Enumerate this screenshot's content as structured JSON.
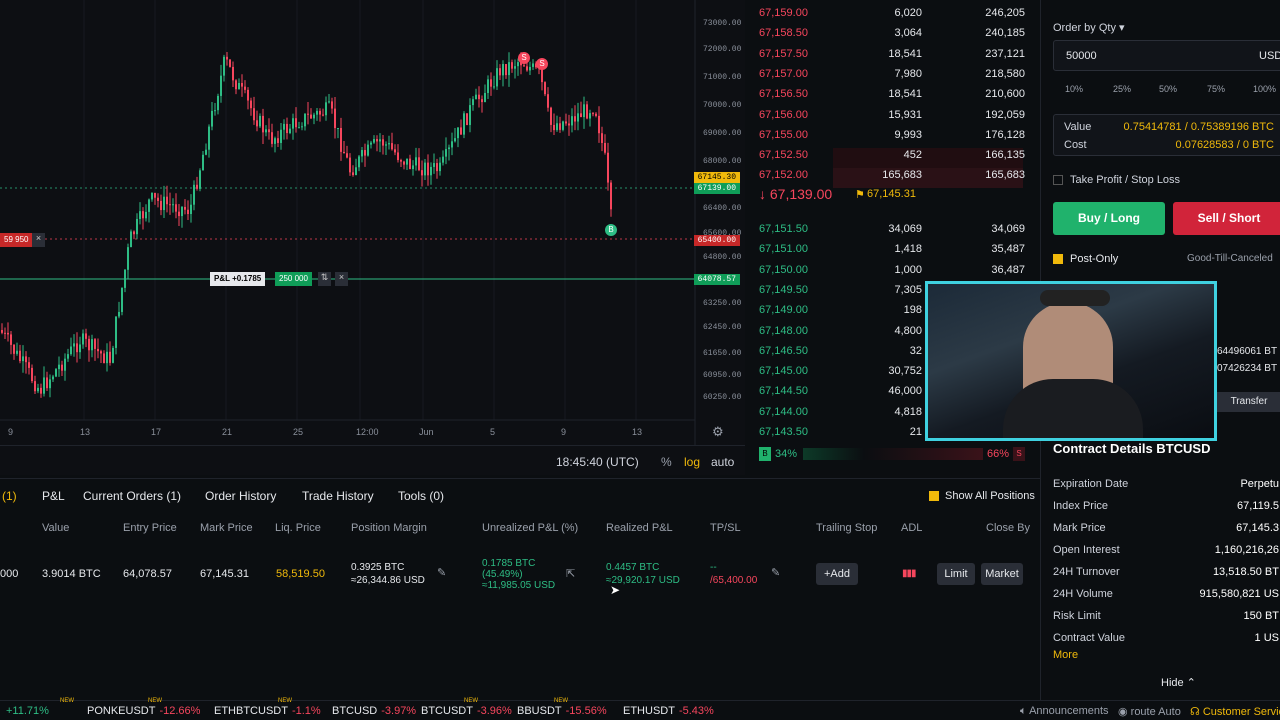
{
  "chart": {
    "y_ticks": [
      "73000.00",
      "72000.00",
      "71000.00",
      "70000.00",
      "69000.00",
      "68000.00",
      "66400.00",
      "65600.00",
      "64800.00",
      "63250.00",
      "62450.00",
      "61650.00",
      "60950.00",
      "60250.00"
    ],
    "x_ticks": [
      "9",
      "13",
      "17",
      "21",
      "25",
      "12:00",
      "Jun",
      "5",
      "9",
      "13"
    ],
    "tag_mark": "67145.30",
    "tag_index": "67139.00",
    "tag_liq": "65400.00",
    "tag_entry": "64078.57",
    "liq_order_label": "59 950",
    "pnl_label": "P&L +0.1785",
    "pnl_qty": "250 000",
    "marker_s": "S",
    "marker_b": "B",
    "time": "18:45:40 (UTC)",
    "pct": "%",
    "log": "log",
    "auto": "auto"
  },
  "book": {
    "asks": [
      {
        "price": "67,159.00",
        "size": "6,020",
        "total": "246,205"
      },
      {
        "price": "67,158.50",
        "size": "3,064",
        "total": "240,185"
      },
      {
        "price": "67,157.50",
        "size": "18,541",
        "total": "237,121"
      },
      {
        "price": "67,157.00",
        "size": "7,980",
        "total": "218,580"
      },
      {
        "price": "67,156.50",
        "size": "18,541",
        "total": "210,600"
      },
      {
        "price": "67,156.00",
        "size": "15,931",
        "total": "192,059"
      },
      {
        "price": "67,155.00",
        "size": "9,993",
        "total": "176,128"
      },
      {
        "price": "67,152.50",
        "size": "452",
        "total": "166,135"
      },
      {
        "price": "67,152.00",
        "size": "165,683",
        "total": "165,683"
      }
    ],
    "last_price": "67,139.00",
    "mark_price": "67,145.31",
    "bids": [
      {
        "price": "67,151.50",
        "size": "34,069",
        "total": "34,069"
      },
      {
        "price": "67,151.00",
        "size": "1,418",
        "total": "35,487"
      },
      {
        "price": "67,150.00",
        "size": "1,000",
        "total": "36,487"
      },
      {
        "price": "67,149.50",
        "size": "7,305",
        "total": ""
      },
      {
        "price": "67,149.00",
        "size": "198",
        "total": ""
      },
      {
        "price": "67,148.00",
        "size": "4,800",
        "total": ""
      },
      {
        "price": "67,146.50",
        "size": "32",
        "total": ""
      },
      {
        "price": "67,145.00",
        "size": "30,752",
        "total": ""
      },
      {
        "price": "67,144.50",
        "size": "46,000",
        "total": ""
      },
      {
        "price": "67,144.00",
        "size": "4,818",
        "total": ""
      },
      {
        "price": "67,143.50",
        "size": "21",
        "total": ""
      }
    ],
    "buy_label": "B",
    "buy_pct": "34%",
    "sell_pct": "66%",
    "sell_label": "S",
    "buy_ratio": 0.34
  },
  "order": {
    "type_label": "Order by Qty ▾",
    "qty": "50000",
    "qty_unit": "USD",
    "pcts": [
      "10%",
      "25%",
      "50%",
      "75%",
      "100%"
    ],
    "value_label": "Value",
    "value": "0.75414781 / 0.75389196 BTC",
    "cost_label": "Cost",
    "cost": "0.07628583 / 0 BTC",
    "tpsl": "Take Profit / Stop Loss",
    "buy": "Buy / Long",
    "sell": "Sell / Short",
    "post_only": "Post-Only",
    "tif": "Good-Till-Canceled",
    "bal1": "64496061 BT",
    "bal2": "07426234 BT",
    "transfer": "Transfer"
  },
  "contract": {
    "title": "Contract Details BTCUSD",
    "rows": [
      {
        "k": "Expiration Date",
        "v": "Perpetu"
      },
      {
        "k": "Index Price",
        "v": "67,119.5"
      },
      {
        "k": "Mark Price",
        "v": "67,145.3"
      },
      {
        "k": "Open Interest",
        "v": "1,160,216,26"
      },
      {
        "k": "24H Turnover",
        "v": "13,518.50 BT"
      },
      {
        "k": "24H Volume",
        "v": "915,580,821 US"
      },
      {
        "k": "Risk Limit",
        "v": "150 BT"
      },
      {
        "k": "Contract Value",
        "v": "1 US"
      }
    ],
    "more": "More",
    "hide": "Hide ⌃"
  },
  "positions": {
    "tabs": [
      "(1)",
      "P&L",
      "Current Orders (1)",
      "Order History",
      "Trade History",
      "Tools (0)"
    ],
    "show_all": "Show All Positions",
    "cols": [
      "Value",
      "Entry Price",
      "Mark Price",
      "Liq. Price",
      "Position Margin",
      "Unrealized P&L (%)",
      "Realized P&L",
      "TP/SL",
      "Trailing Stop",
      "ADL",
      "Close By"
    ],
    "row": {
      "qty": "000",
      "value": "3.9014 BTC",
      "entry": "64,078.57",
      "mark": "67,145.31",
      "liq": "58,519.50",
      "margin1": "0.3925 BTC",
      "margin2": "≈26,344.86 USD",
      "upnl1": "0.1785 BTC",
      "upnl2": "(45.49%)",
      "upnl3": "≈11,985.05 USD",
      "rpnl1": "0.4457 BTC",
      "rpnl2": "≈29,920.17 USD",
      "tp": "--",
      "sl": "/65,400.00",
      "add": "+Add",
      "limit": "Limit",
      "market": "Market"
    }
  },
  "ticker": [
    {
      "name": "",
      "chg": "+11.71%",
      "dir": "up"
    },
    {
      "name": "PONKEUSDT",
      "chg": "-12.66%",
      "dir": "dn"
    },
    {
      "name": "ETHBTCUSDT",
      "chg": "-1.1%",
      "dir": "dn"
    },
    {
      "name": "BTCUSD",
      "chg": "-3.97%",
      "dir": "dn"
    },
    {
      "name": "BTCUSDT",
      "chg": "-3.96%",
      "dir": "dn"
    },
    {
      "name": "BBUSDT",
      "chg": "-15.56%",
      "dir": "dn"
    },
    {
      "name": "ETHUSDT",
      "chg": "-5.43%",
      "dir": "dn"
    }
  ],
  "ticker_new": "NEW",
  "footer": {
    "announcements": "Announcements",
    "route": "route Auto",
    "support": "Customer Servic"
  },
  "colors": {
    "up": "#2ebd85",
    "down": "#f6465d",
    "accent": "#f0b90b"
  }
}
